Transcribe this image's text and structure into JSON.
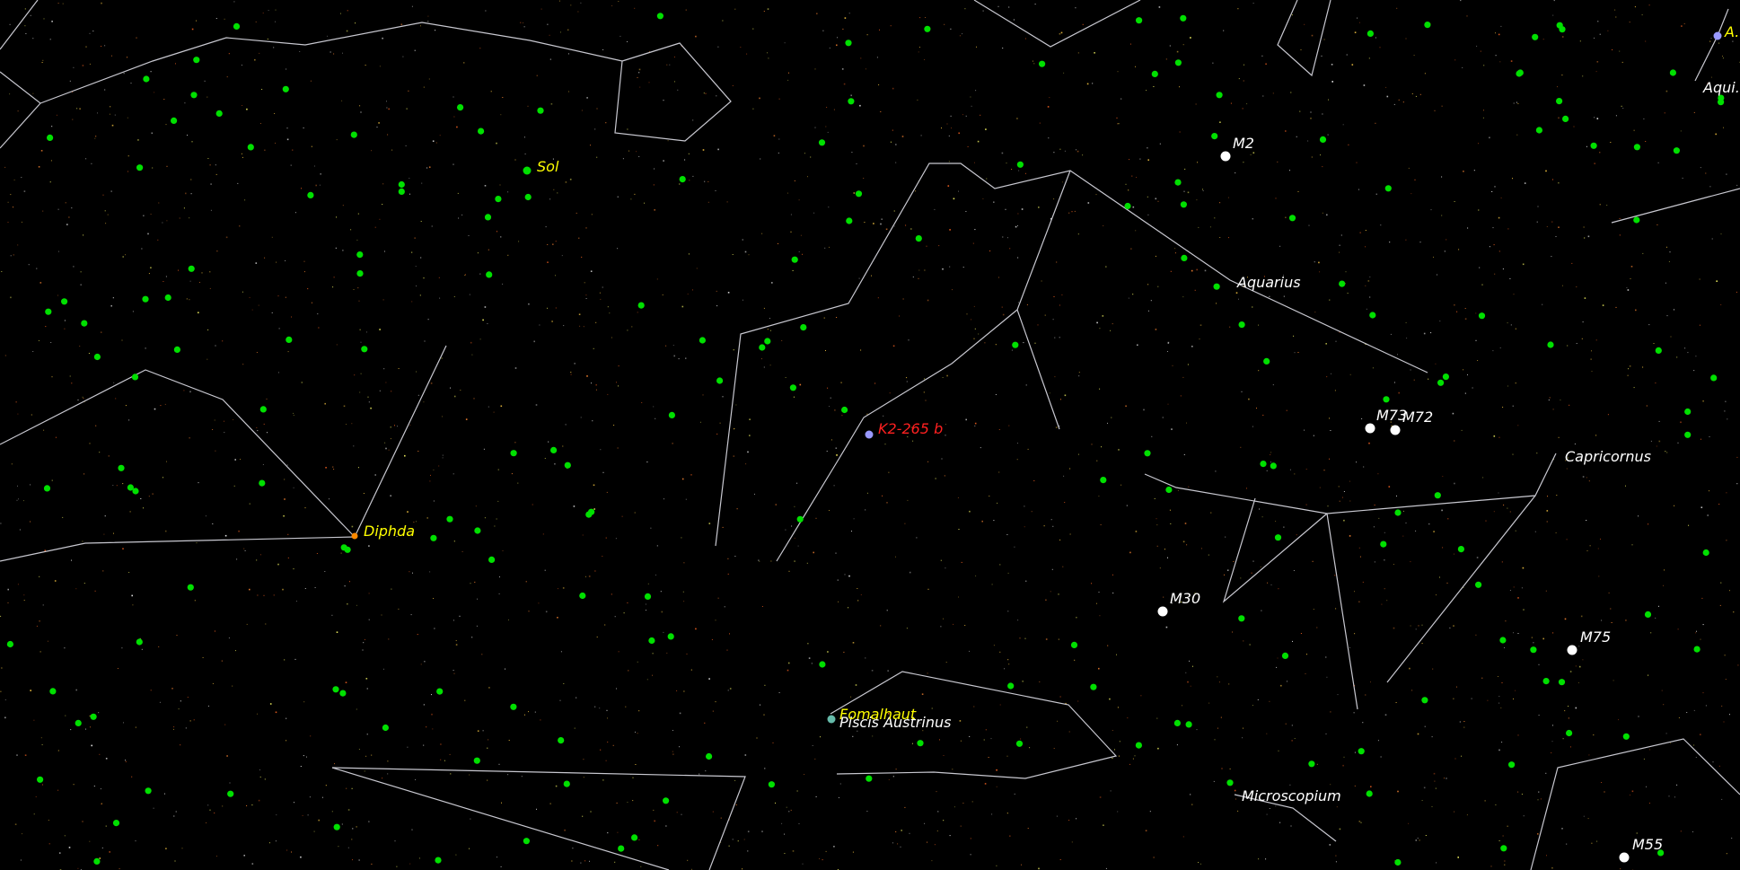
{
  "colors": {
    "background": "#000000",
    "constellation_line": "#c8c8d0",
    "exoplanet_host": "#00e000",
    "named_star_label": "#ffff00",
    "selected_label": "#ff2020",
    "dso_label": "#ffffff",
    "dso_marker": "#ffffff",
    "selected_marker": "#9999ff"
  },
  "labels": {
    "sol": "Sol",
    "diphda": "Diphda",
    "fomalhaut": "Fomalhaut",
    "selected": "K2-265 b",
    "aquarius": "Aquarius",
    "capricornus": "Capricornus",
    "piscis_austrinus": "Piscis Austrinus",
    "microscopium": "Microscopium",
    "m2": "M2",
    "m73": "M73",
    "m72": "M72",
    "m30": "M30",
    "m75": "M75",
    "m55": "M55",
    "edge_top_right": "A...",
    "edge_aquila": "Aqui..."
  }
}
